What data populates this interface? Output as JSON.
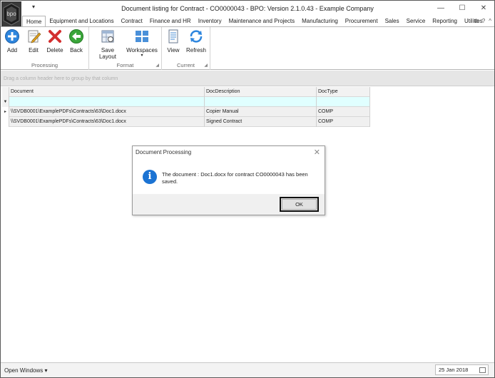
{
  "window": {
    "title": "Document listing for Contract - CO0000043 - BPO: Version 2.1.0.43 - Example Company",
    "logo_text": "bpo",
    "qat_symbol": "▾",
    "controls": {
      "minimize": "—",
      "maximize": "☐",
      "close": "✕"
    }
  },
  "tabs": [
    {
      "label": "Home",
      "active": true
    },
    {
      "label": "Equipment and Locations",
      "active": false
    },
    {
      "label": "Contract",
      "active": false
    },
    {
      "label": "Finance and HR",
      "active": false
    },
    {
      "label": "Inventory",
      "active": false
    },
    {
      "label": "Maintenance and Projects",
      "active": false
    },
    {
      "label": "Manufacturing",
      "active": false
    },
    {
      "label": "Procurement",
      "active": false
    },
    {
      "label": "Sales",
      "active": false
    },
    {
      "label": "Service",
      "active": false
    },
    {
      "label": "Reporting",
      "active": false
    },
    {
      "label": "Utilities",
      "active": false
    }
  ],
  "tab_icons": {
    "restore": "⧉",
    "help": "?",
    "collapse": "^"
  },
  "ribbon": {
    "processing": {
      "label": "Processing",
      "buttons": [
        {
          "label": "Add",
          "icon": "add-icon"
        },
        {
          "label": "Edit",
          "icon": "edit-icon"
        },
        {
          "label": "Delete",
          "icon": "delete-icon"
        },
        {
          "label": "Back",
          "icon": "back-icon"
        }
      ]
    },
    "format": {
      "label": "Format",
      "buttons": [
        {
          "label": "Save Layout",
          "icon": "save-layout-icon"
        },
        {
          "label": "Workspaces",
          "icon": "workspaces-icon"
        }
      ]
    },
    "current": {
      "label": "Current",
      "buttons": [
        {
          "label": "View",
          "icon": "view-icon"
        },
        {
          "label": "Refresh",
          "icon": "refresh-icon"
        }
      ]
    }
  },
  "group_panel_text": "Drag a column header here to group by that column",
  "grid": {
    "columns": [
      "Document",
      "DocDescription",
      "DocType"
    ],
    "filter_symbol": "▼",
    "row_indicator": "▸",
    "rows": [
      [
        "\\\\SVDB0001\\ExamplePDFs\\Contracts\\63\\Doc1.docx",
        "Copier Manual",
        "COMP"
      ],
      [
        "\\\\SVDB0001\\ExamplePDFs\\Contracts\\63\\Doc1.docx",
        "Signed Contract",
        "COMP"
      ]
    ]
  },
  "dialog": {
    "title": "Document Processing",
    "close": "✕",
    "info_glyph": "i",
    "message": "The document : Doc1.docx for contract CO0000043 has been saved.",
    "ok_label": "OK"
  },
  "statusbar": {
    "open_windows": "Open Windows ▾",
    "date": "25 Jan 2018"
  },
  "colors": {
    "filter_row": "#e0ffff",
    "info_blue": "#1b73d3",
    "add_blue": "#2e86de",
    "delete_red": "#d32f2f",
    "back_green": "#3aa63a"
  }
}
